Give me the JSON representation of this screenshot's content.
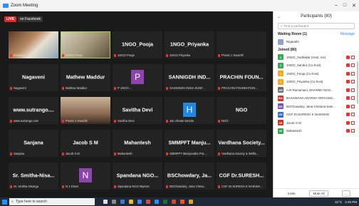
{
  "titlebar": {
    "title": "Zoom Meeting"
  },
  "live": {
    "badge": "LIVE",
    "channel": "on Facebook"
  },
  "tiles": [
    [
      "",
      "",
      "1NGO_Pooja",
      "1NGO_Priyanka",
      ""
    ],
    [
      "Nagaveni",
      "Mathew Maddur",
      "",
      "SANNIGDH IND...",
      "PRACHIN FOUN..."
    ],
    [
      "www.sutrango....",
      "",
      "Savitha Devi",
      "",
      "NGO"
    ],
    [
      "Sanjana",
      "Jacob S M",
      "Mahantesh",
      "SMMPFT Manju...",
      "Vardhana Society..."
    ],
    [
      "Sr. Smitha-Nisa...",
      "",
      "Spandana NGO...",
      "BSChowdary, Ja...",
      "CGF Dr.SURESH..."
    ]
  ],
  "tile_labels": [
    [
      "Maharaja",
      "1NGO Pooja",
      "1NGO Pooja",
      "1NGO Priyanka",
      "Pravin 1 Swachh"
    ],
    [
      "Nagaveni",
      "Mathew Maddur",
      "P 1NGO ...",
      "SANNIGDH INDIA SUNF...",
      "PRACHIN FOUNDATION..."
    ],
    [
      "www.sutrango.com",
      "Pravin 1 Swachh",
      "Savitha Devi",
      "Jan chetan kendra",
      "NGO"
    ],
    [
      "Sanjana",
      "Jacob S M",
      "Mahantesh",
      "SMMPFT Manjunatha Pra...",
      "Vardhana Society & Welfa..."
    ],
    [
      "Sr. Smitha-Nisarga",
      "N 1 Dines",
      "Spandana NGO Mysore",
      "BSChowdary, Jana Cheta...",
      "CGF Dr.SURESH K NAIKWA..."
    ]
  ],
  "tile_avatars": {
    "r1c2": "P",
    "r2c3": "H",
    "r4c1": "N"
  },
  "sidebar": {
    "title": "Participants (80)",
    "find_placeholder": "Find a participant",
    "waiting_label": "Waiting Room (1)",
    "waiting_action": "Message",
    "waiting_person": "Rajarathi",
    "joined_label": "Joined (80)",
    "participants": [
      {
        "initial": "1",
        "name": "1NGO_Sudhakar (Host, me)",
        "color": "#3aa757"
      },
      {
        "initial": "1",
        "name": "1NGO_Sandra (Co-host)",
        "color": "#3aa757"
      },
      {
        "initial": "1",
        "name": "1NGO_Pooja (Co-host)",
        "color": "#f4a81e"
      },
      {
        "initial": "1",
        "name": "1NGO_Priyanka (Co-host)",
        "color": "#f4a81e"
      },
      {
        "initial": "AR",
        "name": "A.R Ramamani, DHARMA NGO...",
        "color": "#6d6d6d"
      },
      {
        "initial": "BA",
        "name": "BASAWANA ADARSH ORGANIZ...",
        "color": "#c0392b"
      },
      {
        "initial": "BS",
        "name": "BSChowdary, Jana Chetana Sam...",
        "color": "#7b4fbf"
      },
      {
        "initial": "CK",
        "name": "CGF Dr.SURESH K NAIKWAD",
        "color": "#2d6fd0"
      },
      {
        "initial": "JS",
        "name": "Jacob S M",
        "color": "#c0392b"
      },
      {
        "initial": "M",
        "name": "Mahantesh",
        "color": "#3aa757"
      }
    ],
    "invite": "Invite",
    "mute_all": "Mute All",
    "more": "..."
  },
  "taskbar": {
    "search_placeholder": "Type here to search",
    "time": "2:45 PM",
    "temp": "31°C"
  }
}
